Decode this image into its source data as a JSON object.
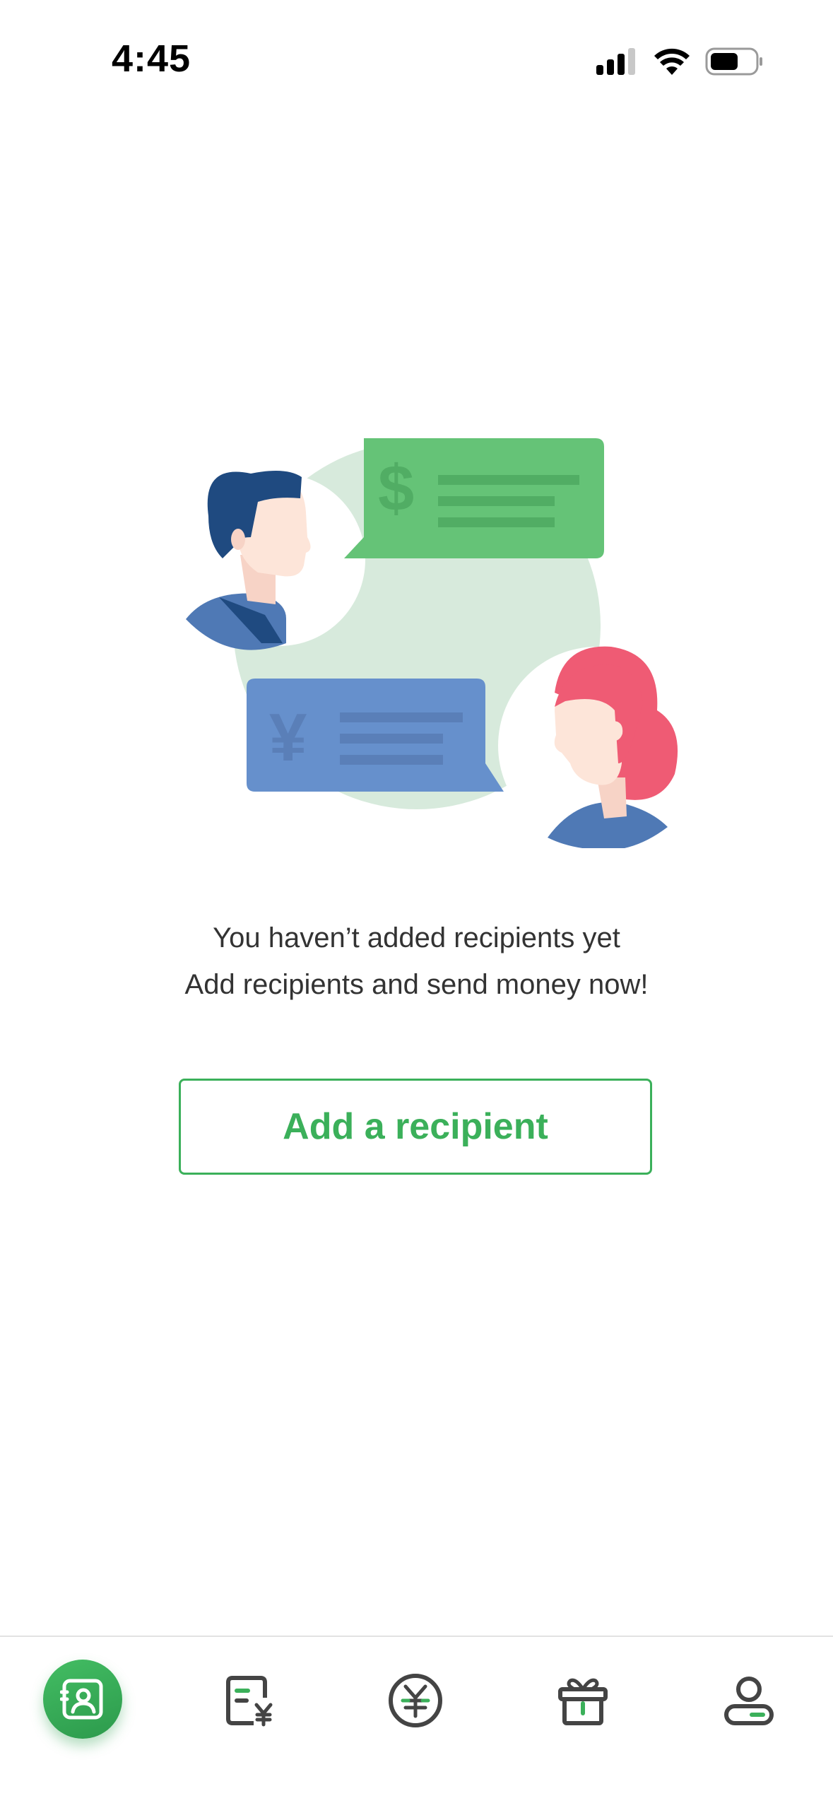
{
  "status_bar": {
    "time": "4:45",
    "icons": [
      "cellular-signal-icon",
      "wifi-icon",
      "battery-icon"
    ]
  },
  "illustration": {
    "name": "recipients-illustration",
    "currency_symbols": [
      "$",
      "¥"
    ]
  },
  "empty_state": {
    "title": "You haven’t added recipients yet",
    "subtitle": "Add recipients and send money now!"
  },
  "cta": {
    "add_recipient_label": "Add a recipient"
  },
  "tab_bar": {
    "tabs": [
      {
        "icon": "recipients-icon",
        "active": true
      },
      {
        "icon": "transactions-icon",
        "active": false
      },
      {
        "icon": "send-money-icon",
        "active": false
      },
      {
        "icon": "gift-icon",
        "active": false
      },
      {
        "icon": "account-icon",
        "active": false
      }
    ]
  },
  "colors": {
    "accent_green": "#3bb05a",
    "bubble_green": "#65c377",
    "bubble_blue": "#6690cc",
    "backdrop_circle": "#d7eadc",
    "woman_hair": "#ef5b74",
    "man_hair": "#1f4a80",
    "skin": "#fde5d9",
    "shirt_blue": "#4f79b5",
    "icon_gray": "#444444"
  }
}
